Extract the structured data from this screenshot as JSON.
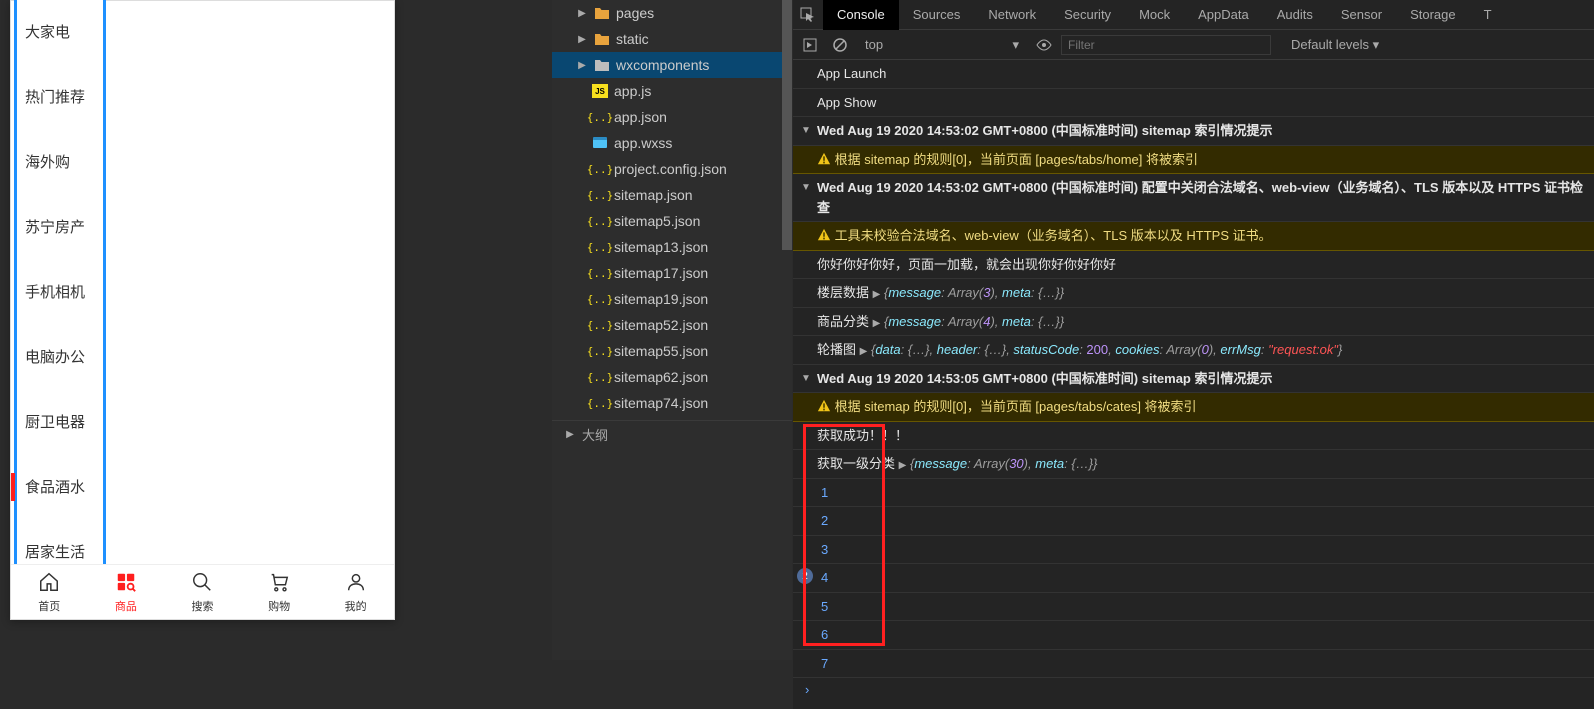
{
  "phone": {
    "cates": [
      "大家电",
      "热门推荐",
      "海外购",
      "苏宁房产",
      "手机相机",
      "电脑办公",
      "厨卫电器",
      "食品酒水",
      "居家生活"
    ],
    "active_cate_index": 7,
    "tabs": [
      {
        "label": "首页",
        "key": "home"
      },
      {
        "label": "商品",
        "key": "goods"
      },
      {
        "label": "搜索",
        "key": "search"
      },
      {
        "label": "购物",
        "key": "cart"
      },
      {
        "label": "我的",
        "key": "me"
      }
    ],
    "active_tab_index": 1
  },
  "explorer": {
    "folders": [
      {
        "label": "pages",
        "color": "orange"
      },
      {
        "label": "static",
        "color": "orange"
      },
      {
        "label": "wxcomponents",
        "color": "grey",
        "selected": true
      }
    ],
    "files": [
      {
        "label": "app.js",
        "type": "js"
      },
      {
        "label": "app.json",
        "type": "json"
      },
      {
        "label": "app.wxss",
        "type": "wxss"
      },
      {
        "label": "project.config.json",
        "type": "json"
      },
      {
        "label": "sitemap.json",
        "type": "json"
      },
      {
        "label": "sitemap5.json",
        "type": "json"
      },
      {
        "label": "sitemap13.json",
        "type": "json"
      },
      {
        "label": "sitemap17.json",
        "type": "json"
      },
      {
        "label": "sitemap19.json",
        "type": "json"
      },
      {
        "label": "sitemap52.json",
        "type": "json"
      },
      {
        "label": "sitemap55.json",
        "type": "json"
      },
      {
        "label": "sitemap62.json",
        "type": "json"
      },
      {
        "label": "sitemap74.json",
        "type": "json"
      }
    ],
    "outline_label": "大纲"
  },
  "devtools": {
    "tabs": [
      "Console",
      "Sources",
      "Network",
      "Security",
      "Mock",
      "AppData",
      "Audits",
      "Sensor",
      "Storage",
      "T"
    ],
    "active_tab": 0,
    "context": "top",
    "filter_placeholder": "Filter",
    "levels": "Default levels ▾",
    "logs": [
      {
        "t": "simple",
        "text": "App Launch"
      },
      {
        "t": "simple",
        "text": "App Show"
      },
      {
        "t": "group",
        "text": "Wed Aug 19 2020 14:53:02 GMT+0800 (中国标准时间) sitemap 索引情况提示"
      },
      {
        "t": "warn",
        "text": "根据 sitemap 的规则[0]，当前页面 [pages/tabs/home] 将被索引"
      },
      {
        "t": "group",
        "text": "Wed Aug 19 2020 14:53:02 GMT+0800 (中国标准时间) 配置中关闭合法域名、web-view（业务域名）、TLS 版本以及 HTTPS 证书检查"
      },
      {
        "t": "warn",
        "text": "工具未校验合法域名、web-view（业务域名）、TLS 版本以及 HTTPS 证书。"
      },
      {
        "t": "simple",
        "text": "你好你好你好，页面一加载，就会出现你好你好你好"
      },
      {
        "t": "obj",
        "label": "楼层数据",
        "obj": "{message: Array(3), meta: {…}}"
      },
      {
        "t": "obj",
        "label": "商品分类",
        "obj": "{message: Array(4), meta: {…}}"
      },
      {
        "t": "http",
        "label": "轮播图",
        "data": "{data: {…}, header: {…}, statusCode: ",
        "code": "200",
        "tail": ", cookies: Array(0), errMsg: ",
        "err": "\"request:ok\"",
        "end": "}"
      },
      {
        "t": "group",
        "text": "Wed Aug 19 2020 14:53:05 GMT+0800 (中国标准时间) sitemap 索引情况提示"
      },
      {
        "t": "warn",
        "text": "根据 sitemap 的规则[0]，当前页面 [pages/tabs/cates] 将被索引"
      },
      {
        "t": "simple",
        "text": "获取成功！！！"
      },
      {
        "t": "obj",
        "label": "获取一级分类",
        "obj": "{message: Array(30), meta: {…}}"
      }
    ],
    "sequence": [
      "1",
      "2",
      "3",
      "4",
      "5",
      "6",
      "7"
    ],
    "sequence_badge_index": 3,
    "sequence_badge_count": "2"
  }
}
